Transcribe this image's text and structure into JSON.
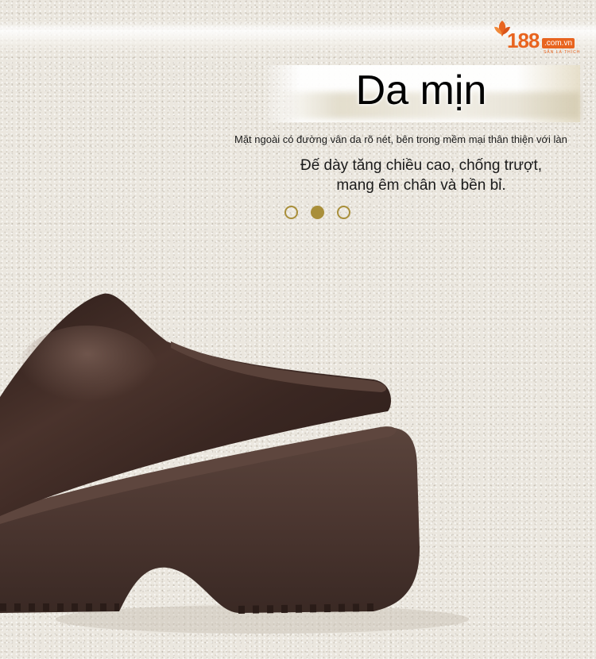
{
  "logo": {
    "number": "188",
    "domain": ".com.vn",
    "tagline": "SĂN LÀ THÍCH",
    "brand_color": "#e8641f"
  },
  "banner": {
    "title": "Da mịn",
    "subtitle": "Mặt ngoài có đường vân da rõ nét, bên trong mềm mại thân thiện với làn",
    "description": "Đế dày tăng chiều cao, chống trượt, mang êm chân và bền bỉ."
  },
  "carousel": {
    "slide_count": 3,
    "active_index": 1,
    "accent_color": "#a98f3a"
  },
  "product_image": {
    "icon": "brown-platform-slipper-photo",
    "upper_color": "#3f2a24",
    "sole_color": "#4b3630"
  }
}
